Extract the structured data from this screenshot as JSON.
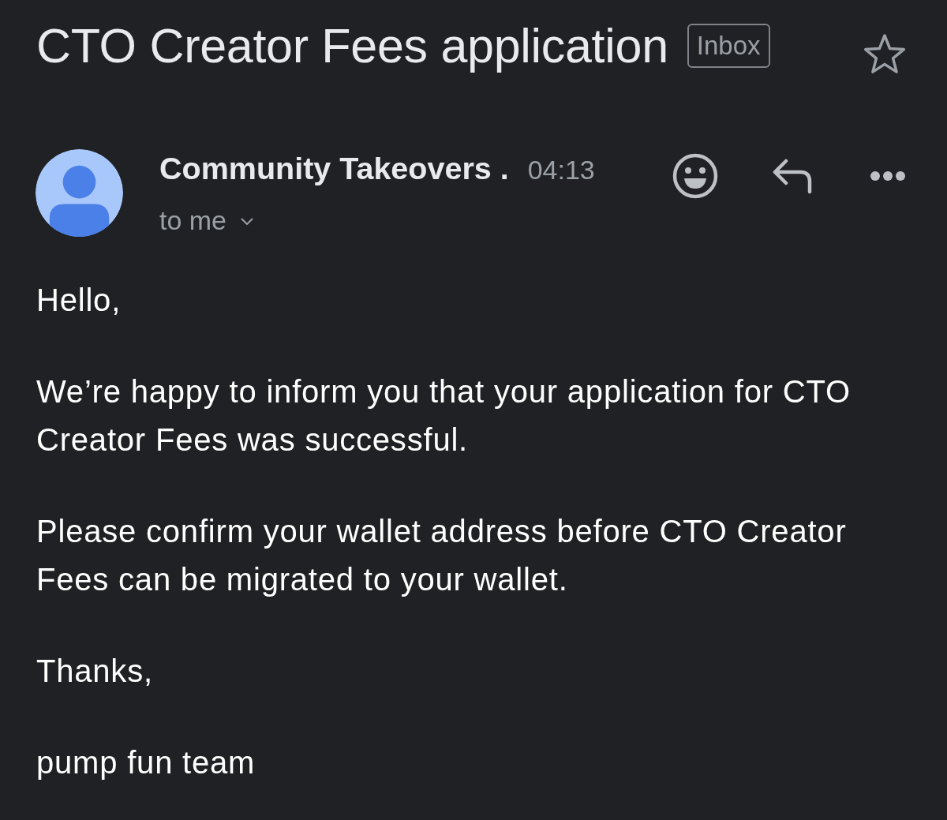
{
  "subject": {
    "title": "CTO Creator Fees application",
    "label": "Inbox",
    "starred": false
  },
  "message": {
    "sender": "Community Takeovers .",
    "time": "04:13",
    "recipient": "to me"
  },
  "body": [
    "Hello,",
    "We’re happy to inform you that your application for CTO Creator Fees was successful.",
    "Please confirm your wallet address before CTO Creator Fees can be migrated to your wallet.",
    "Thanks,",
    "pump fun team"
  ]
}
